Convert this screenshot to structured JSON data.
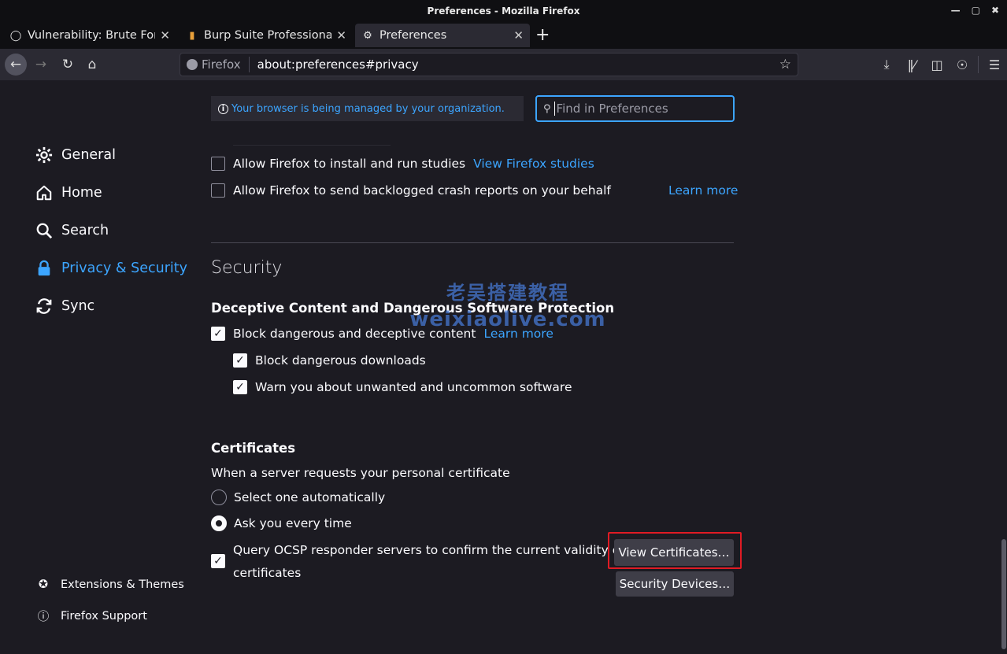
{
  "window": {
    "title": "Preferences - Mozilla Firefox"
  },
  "tabs": [
    {
      "label": "Vulnerability: Brute Force",
      "icon": "dvwa-icon",
      "active": false
    },
    {
      "label": "Burp Suite Professional",
      "icon": "burp-icon",
      "active": false
    },
    {
      "label": "Preferences",
      "icon": "gear-icon",
      "active": true
    }
  ],
  "navbar": {
    "identity_label": "Firefox",
    "url": "about:preferences#privacy"
  },
  "sidebar": {
    "categories": [
      {
        "label": "General",
        "icon": "gear-icon"
      },
      {
        "label": "Home",
        "icon": "home-icon"
      },
      {
        "label": "Search",
        "icon": "search-icon"
      },
      {
        "label": "Privacy & Security",
        "icon": "lock-icon",
        "selected": true
      },
      {
        "label": "Sync",
        "icon": "sync-icon"
      }
    ],
    "footer": [
      {
        "label": "Extensions & Themes",
        "icon": "puzzle-icon"
      },
      {
        "label": "Firefox Support",
        "icon": "help-icon"
      }
    ]
  },
  "banner": {
    "managed_text": "Your browser is being managed by your organization."
  },
  "search": {
    "placeholder": "Find in Preferences"
  },
  "data_collection": {
    "studies_label": "Allow Firefox to install and run studies",
    "studies_link": "View Firefox studies",
    "crash_label": "Allow Firefox to send backlogged crash reports on your behalf",
    "crash_link": "Learn more"
  },
  "security": {
    "heading": "Security",
    "deceptive": {
      "heading": "Deceptive Content and Dangerous Software Protection",
      "block_label": "Block dangerous and deceptive content",
      "block_link": "Learn more",
      "downloads_label": "Block dangerous downloads",
      "unwanted_label": "Warn you about unwanted and uncommon software"
    },
    "certificates": {
      "heading": "Certificates",
      "description": "When a server requests your personal certificate",
      "radio_auto": "Select one automatically",
      "radio_ask": "Ask you every time",
      "ocsp_line1": "Query OCSP responder servers to confirm the current validity of",
      "ocsp_line2": "certificates",
      "view_button": "View Certificates…",
      "devices_button": "Security Devices…"
    }
  },
  "watermark": {
    "line1": "老吴搭建教程",
    "line2": "weixiaolive.com"
  },
  "colors": {
    "accent": "#3ca5ff",
    "highlight_box": "#e01b24",
    "background": "#1c1b22"
  }
}
